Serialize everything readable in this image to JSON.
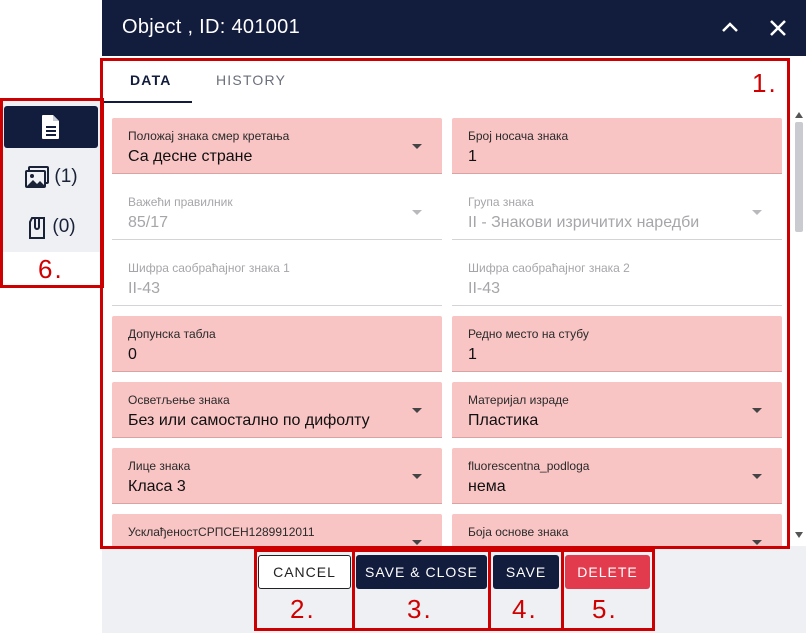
{
  "window": {
    "title": "Object , ID: 401001"
  },
  "rail": {
    "items": [
      {
        "icon": "document-icon",
        "label": ""
      },
      {
        "icon": "images-icon",
        "label": "(1)"
      },
      {
        "icon": "attachment-icon",
        "label": "(0)"
      }
    ]
  },
  "tabs": [
    {
      "label": "DATA",
      "active": true
    },
    {
      "label": "HISTORY",
      "active": false
    }
  ],
  "fields": [
    {
      "label": "Положај знака смер кретања",
      "value": "Са десне стране",
      "dropdown": true,
      "disabled": false
    },
    {
      "label": "Број носача знака",
      "value": "1",
      "dropdown": false,
      "disabled": false
    },
    {
      "label": "Важећи правилник",
      "value": "85/17",
      "dropdown": true,
      "disabled": true
    },
    {
      "label": "Група знака",
      "value": "II - Знакови изричитих наредби",
      "dropdown": true,
      "disabled": true
    },
    {
      "label": "Шифра саобраћајног знака 1",
      "value": "II-43",
      "dropdown": false,
      "disabled": true
    },
    {
      "label": "Шифра саобраћајног знака 2",
      "value": "II-43",
      "dropdown": false,
      "disabled": true
    },
    {
      "label": "Допунска табла",
      "value": "0",
      "dropdown": false,
      "disabled": false
    },
    {
      "label": "Редно место на стубу",
      "value": "1",
      "dropdown": false,
      "disabled": false
    },
    {
      "label": "Осветљење знака",
      "value": "Без или самостално по дифолту",
      "dropdown": true,
      "disabled": false
    },
    {
      "label": "Материјал израде",
      "value": "Пластика",
      "dropdown": true,
      "disabled": false
    },
    {
      "label": "Лице знака",
      "value": "Класа 3",
      "dropdown": true,
      "disabled": false
    },
    {
      "label": "fluorescentna_podloga",
      "value": "нема",
      "dropdown": true,
      "disabled": false
    },
    {
      "label": "УсклађеностСРПСЕН1289912011",
      "value": "",
      "dropdown": true,
      "disabled": false
    },
    {
      "label": "Боја основе знака",
      "value": "",
      "dropdown": true,
      "disabled": false
    }
  ],
  "buttons": {
    "cancel": "CANCEL",
    "save_close": "SAVE & CLOSE",
    "save": "SAVE",
    "delete": "DELETE"
  },
  "annotations": [
    "1.",
    "2.",
    "3.",
    "4.",
    "5.",
    "6."
  ],
  "colors": {
    "navy": "#121c3d",
    "field_pink": "#f9c4c4",
    "delete_red": "#e23b4e",
    "annotation_red": "#cc0000"
  }
}
